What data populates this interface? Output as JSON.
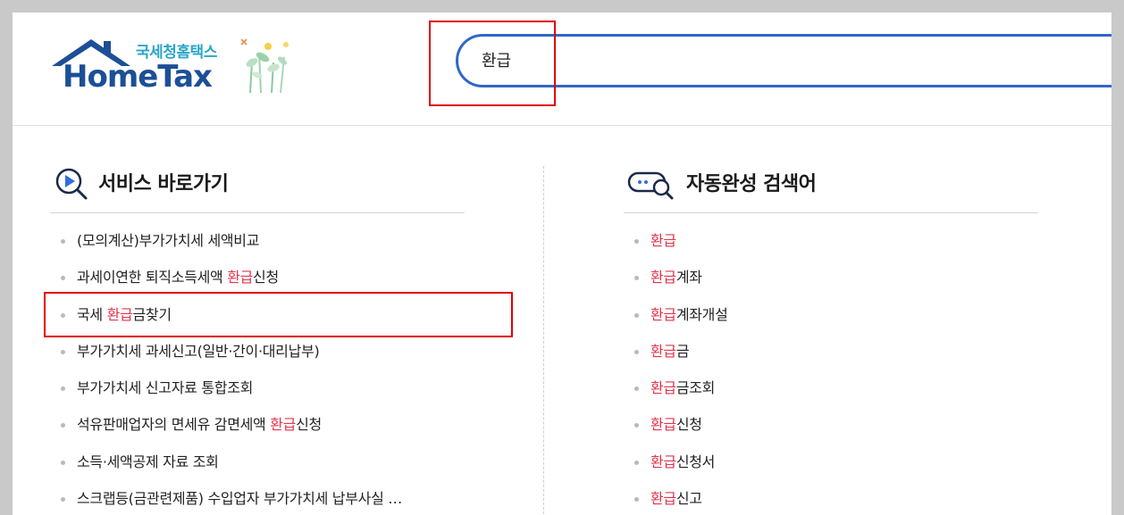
{
  "logo": {
    "korean": "국세청홈택스",
    "english": "HomeTax"
  },
  "search": {
    "value": "환급",
    "placeholder": ""
  },
  "services": {
    "title": "서비스 바로가기",
    "items": [
      {
        "before": "(모의계산)부가가치세 세액비교",
        "keyword": "",
        "after": ""
      },
      {
        "before": "과세이연한 퇴직소득세액 ",
        "keyword": "환급",
        "after": "신청"
      },
      {
        "before": "국세 ",
        "keyword": "환급",
        "after": "금찾기"
      },
      {
        "before": "부가가치세 과세신고(일반·간이·대리납부)",
        "keyword": "",
        "after": ""
      },
      {
        "before": "부가가치세 신고자료 통합조회",
        "keyword": "",
        "after": ""
      },
      {
        "before": "석유판매업자의 면세유 감면세액 ",
        "keyword": "환급",
        "after": "신청"
      },
      {
        "before": "소득·세액공제 자료 조회",
        "keyword": "",
        "after": ""
      },
      {
        "before": "스크랩등(금관련제품) 수입업자 부가가치세 납부사실 …",
        "keyword": "",
        "after": ""
      }
    ]
  },
  "autocomplete": {
    "title": "자동완성 검색어",
    "items": [
      {
        "keyword": "환급",
        "after": ""
      },
      {
        "keyword": "환급",
        "after": "계좌"
      },
      {
        "keyword": "환급",
        "after": "계좌개설"
      },
      {
        "keyword": "환급",
        "after": "금"
      },
      {
        "keyword": "환급",
        "after": "금조회"
      },
      {
        "keyword": "환급",
        "after": "신청"
      },
      {
        "keyword": "환급",
        "after": "신청서"
      },
      {
        "keyword": "환급",
        "after": "신고"
      }
    ]
  },
  "colors": {
    "brand_blue": "#1c4f96",
    "search_border": "#3166c9",
    "keyword_highlight": "#e2364e",
    "annotation_red": "#e00000"
  }
}
